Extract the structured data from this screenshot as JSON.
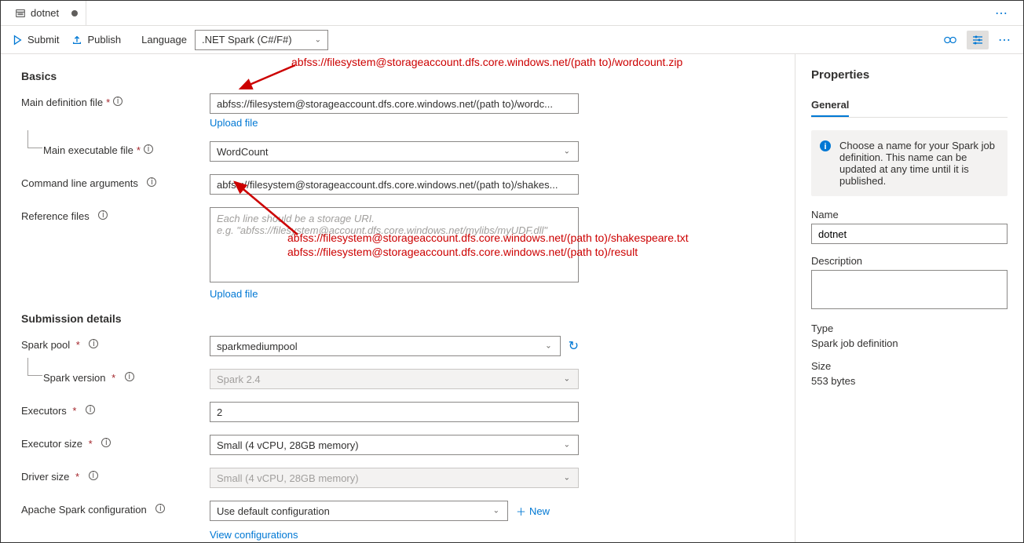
{
  "tab": {
    "title": "dotnet"
  },
  "toolbar": {
    "submit": "Submit",
    "publish": "Publish",
    "language_label": "Language",
    "language_value": ".NET Spark (C#/F#)",
    "new": "New"
  },
  "basics": {
    "title": "Basics",
    "main_def_label": "Main definition file",
    "main_def_value": "abfss://filesystem@storageaccount.dfs.core.windows.net/(path to)/wordc...",
    "upload_file": "Upload file",
    "main_exec_label": "Main executable file",
    "main_exec_value": "WordCount",
    "cmd_args_label": "Command line arguments",
    "cmd_args_value": "abfss://filesystem@storageaccount.dfs.core.windows.net/(path to)/shakes...",
    "ref_files_label": "Reference files",
    "ref_files_placeholder": "Each line should be a storage URI.\ne.g. \"abfss://filesystem@account.dfs.core.windows.net/mylibs/myUDF.dll\""
  },
  "annotations": {
    "a1": "abfss://filesystem@storageaccount.dfs.core.windows.net/(path to)/wordcount.zip",
    "a2": "abfss://filesystem@storageaccount.dfs.core.windows.net/(path to)/shakespeare.txt",
    "a3": "abfss://filesystem@storageaccount.dfs.core.windows.net/(path to)/result"
  },
  "submission": {
    "title": "Submission details",
    "spark_pool_label": "Spark pool",
    "spark_pool_value": "sparkmediumpool",
    "spark_version_label": "Spark version",
    "spark_version_value": "Spark 2.4",
    "executors_label": "Executors",
    "executors_value": "2",
    "executor_size_label": "Executor size",
    "executor_size_value": "Small (4 vCPU, 28GB memory)",
    "driver_size_label": "Driver size",
    "driver_size_value": "Small (4 vCPU, 28GB memory)",
    "spark_config_label": "Apache Spark configuration",
    "spark_config_value": "Use default configuration",
    "view_configs": "View configurations"
  },
  "properties": {
    "title": "Properties",
    "tab_general": "General",
    "info": "Choose a name for your Spark job definition. This name can be updated at any time until it is published.",
    "name_label": "Name",
    "name_value": "dotnet",
    "desc_label": "Description",
    "desc_value": "",
    "type_label": "Type",
    "type_value": "Spark job definition",
    "size_label": "Size",
    "size_value": "553 bytes"
  }
}
